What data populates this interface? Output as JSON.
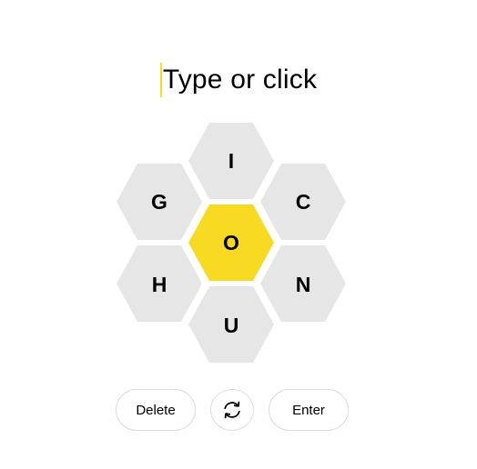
{
  "input": {
    "placeholder": "Type or click"
  },
  "hive": {
    "center_letter": "O",
    "outer_letters": {
      "top": "I",
      "upper_left": "G",
      "upper_right": "C",
      "lower_left": "H",
      "lower_right": "N",
      "bottom": "U"
    }
  },
  "controls": {
    "delete_label": "Delete",
    "shuffle_icon": "shuffle-icon",
    "enter_label": "Enter"
  },
  "colors": {
    "center_cell": "#f7da21",
    "outer_cell": "#e6e6e6",
    "caret": "#f7da21"
  }
}
